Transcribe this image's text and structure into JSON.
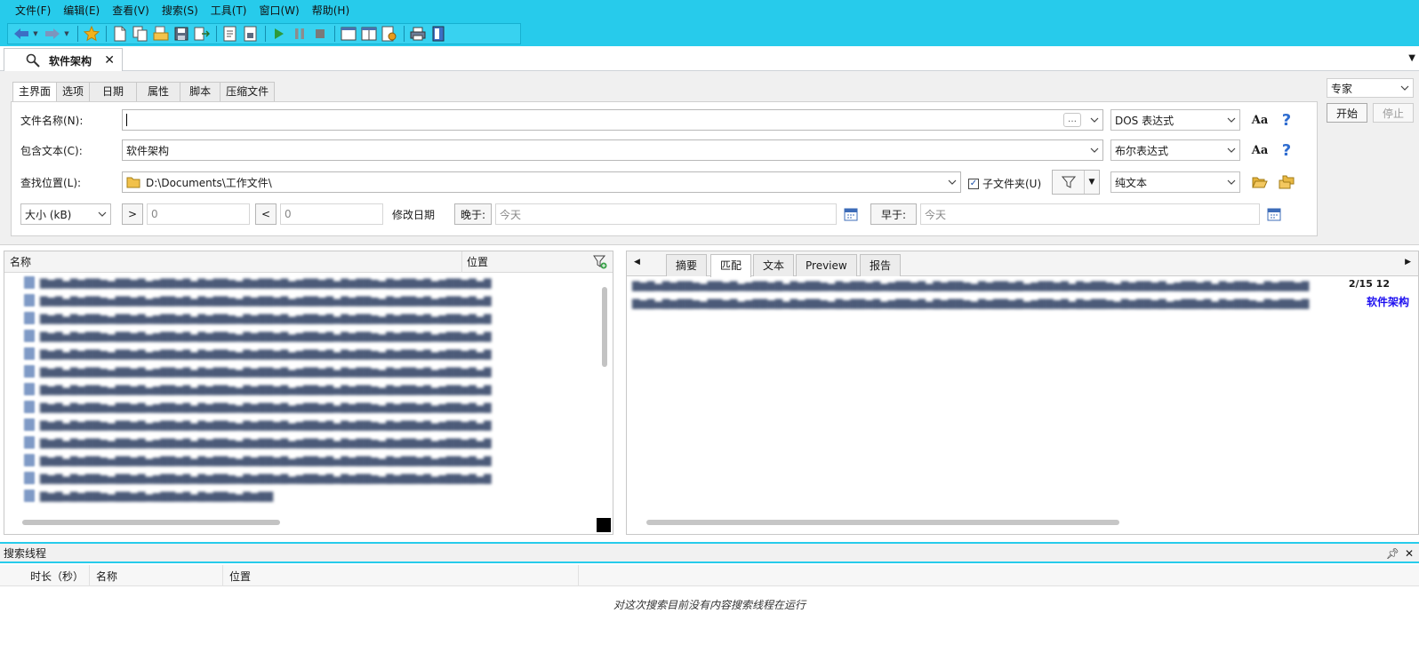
{
  "menu": [
    "文件(F)",
    "编辑(E)",
    "查看(V)",
    "搜索(S)",
    "工具(T)",
    "窗口(W)",
    "帮助(H)"
  ],
  "colors": {
    "accent": "#27cbeb",
    "highlight": "#1c0ef0"
  },
  "doc_tab": {
    "label": "软件架构",
    "icon": "search-icon"
  },
  "option_tabs": [
    "主界面",
    "选项",
    "日期",
    "属性",
    "脚本",
    "压缩文件"
  ],
  "form": {
    "filename_label": "文件名称(N):",
    "filename_value": "",
    "filename_mode": "DOS 表达式",
    "content_label": "包含文本(C):",
    "content_value": "软件架构",
    "content_mode": "布尔表达式",
    "location_label": "查找位置(L):",
    "location_value": "D:\\Documents\\工作文件\\",
    "subfolder_label": "子文件夹(U)",
    "subfolder_checked": true,
    "text_mode": "纯文本",
    "size_select": "大小 (kB)",
    "gt_label": ">",
    "gt_value": "0",
    "lt_label": "<",
    "lt_value": "0",
    "modified_label": "修改日期",
    "after_label": "晚于:",
    "after_value": "今天",
    "before_label": "早于:",
    "before_value": "今天",
    "case_label": "Aa",
    "help_label": "?",
    "ellipsis": "…"
  },
  "side": {
    "mode": "专家",
    "start": "开始",
    "stop": "停止"
  },
  "results": {
    "col_name": "名称",
    "col_location": "位置"
  },
  "preview": {
    "tabs": [
      "摘要",
      "匹配",
      "文本",
      "Preview",
      "报告"
    ],
    "active_tab": "匹配",
    "date_fragment": "2/15 12",
    "highlight": "软件架构"
  },
  "threads": {
    "title": "搜索线程",
    "cols": [
      "时长（秒）",
      "名称",
      "位置"
    ],
    "message": "对这次搜索目前没有内容搜索线程在运行"
  }
}
